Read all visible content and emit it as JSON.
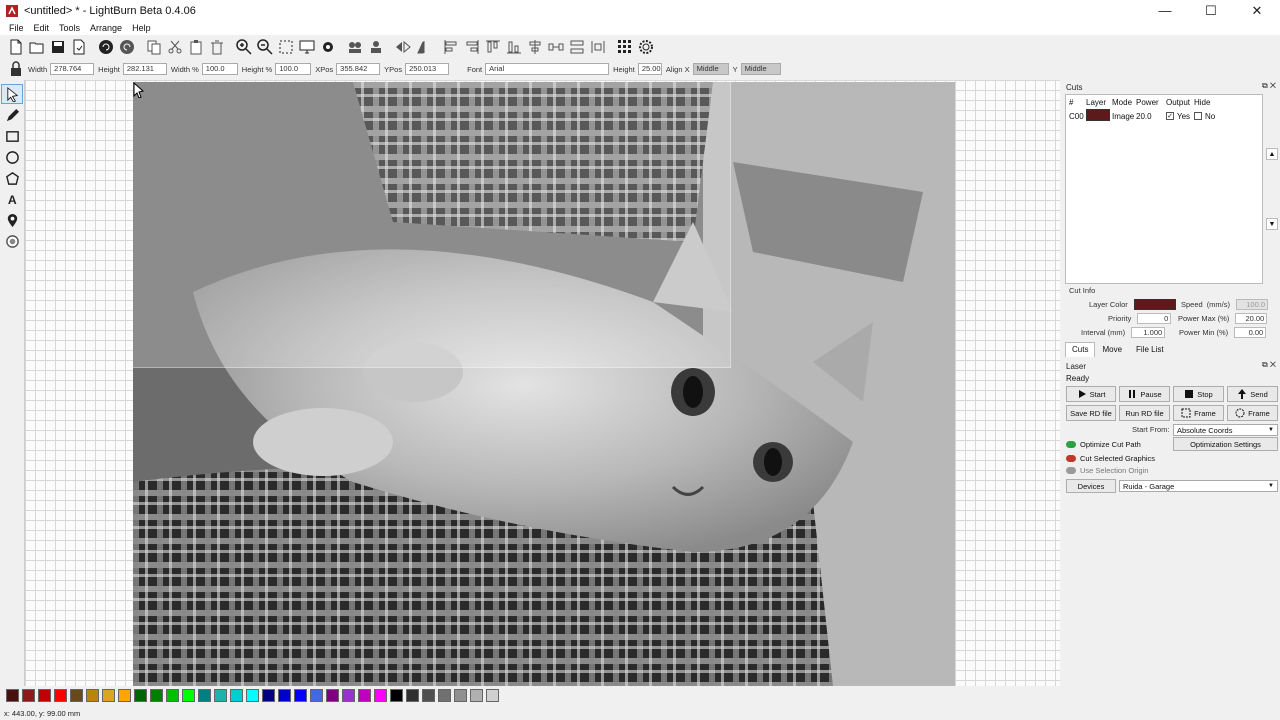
{
  "window": {
    "title": "<untitled> * - LightBurn Beta 0.4.06",
    "minimize": "—",
    "maximize": "☐",
    "close": "✕"
  },
  "menu": [
    "File",
    "Edit",
    "Tools",
    "Arrange",
    "Help"
  ],
  "toolbar": {
    "icons": [
      "new-file-icon",
      "open-file-icon",
      "save-icon",
      "save-as-icon",
      "undo-icon",
      "redo-icon",
      "copy-icon",
      "cut-icon",
      "paste-icon",
      "delete-icon",
      "zoom-in-icon",
      "zoom-out-icon",
      "zoom-frame-icon",
      "monitor-icon",
      "settings-icon",
      "group-icon",
      "ungroup-icon",
      "mirror-h-icon",
      "mirror-v-icon",
      "align-left-icon",
      "align-right-icon",
      "align-top-icon",
      "align-bottom-icon",
      "align-center-v-icon",
      "distribute-h-icon",
      "distribute-v-icon",
      "distribute-space-icon",
      "grid-array-icon",
      "gear-icon"
    ]
  },
  "props": {
    "width_label": "Width",
    "width_value": "278.764",
    "height_label": "Height",
    "height_value": "282.131",
    "width_pct_label": "Width %",
    "width_pct_value": "100.0",
    "height_pct_label": "Height %",
    "height_pct_value": "100.0",
    "xpos_label": "XPos",
    "xpos_value": "355.842",
    "ypos_label": "YPos",
    "ypos_value": "250.013",
    "font_label": "Font",
    "font_value": "Arial",
    "height2_label": "Height",
    "height2_value": "25.00",
    "alignx_label": "Align X",
    "alignx_value": "Middle",
    "aligny_label": "Y",
    "aligny_value": "Middle"
  },
  "cuts": {
    "panel_title": "Cuts",
    "headers": [
      "#",
      "Layer",
      "Mode",
      "Power",
      "Output",
      "Hide"
    ],
    "rows": [
      {
        "num": "C00",
        "mode": "Image",
        "power": "20.0",
        "output": "Yes",
        "hide": "No"
      }
    ],
    "layer_color": "#5c1a1a"
  },
  "cut_info": {
    "title": "Cut Info",
    "layer_color_label": "Layer Color",
    "priority_label": "Priority",
    "priority_value": "0",
    "interval_label": "Interval (mm)",
    "interval_value": "1.000",
    "speed_label": "Speed",
    "speed_unit": "(mm/s)",
    "speed_value": "100.0",
    "power_max_label": "Power Max (%)",
    "power_max_value": "20.00",
    "power_min_label": "Power Min (%)",
    "power_min_value": "0.00"
  },
  "tabs": [
    "Cuts",
    "Move",
    "File List"
  ],
  "laser": {
    "title": "Laser",
    "status": "Ready",
    "start": "Start",
    "pause": "Pause",
    "stop": "Stop",
    "send": "Send",
    "save_rd": "Save RD file",
    "run_rd": "Run RD file",
    "frame1": "Frame",
    "frame2": "Frame",
    "start_from_label": "Start From:",
    "start_from_value": "Absolute Coords",
    "optimize_cut_path": "Optimize Cut Path",
    "optimization_settings": "Optimization Settings",
    "cut_selected": "Cut Selected Graphics",
    "use_selection_origin": "Use Selection Origin",
    "devices": "Devices",
    "device_value": "Ruida - Garage"
  },
  "palette": [
    "#4a0f0f",
    "#8b1a1a",
    "#c00000",
    "#ff0000",
    "#6b4a1a",
    "#b8860b",
    "#daa520",
    "#ffa500",
    "#006400",
    "#008000",
    "#00c000",
    "#00ff00",
    "#008080",
    "#20b2aa",
    "#00ced1",
    "#00ffff",
    "#000080",
    "#0000cd",
    "#0000ff",
    "#4169e1",
    "#800080",
    "#9932cc",
    "#c000c0",
    "#ff00ff",
    "#000000",
    "#303030",
    "#505050",
    "#707070",
    "#909090",
    "#b0b0b0",
    "#d0d0d0"
  ],
  "status": {
    "coords": "x: 443.00, y: 99.00 mm"
  }
}
